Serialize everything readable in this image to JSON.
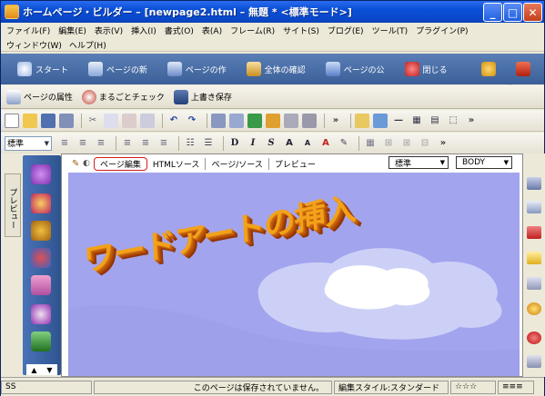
{
  "window": {
    "title": "ホームページ・ビルダー – [newpage2.html – 無題 * <標準モード>]"
  },
  "menu": {
    "row1": [
      "ファイル(F)",
      "編集(E)",
      "表示(V)",
      "挿入(I)",
      "書式(O)",
      "表(A)",
      "フレーム(R)",
      "サイト(S)",
      "ブログ(E)",
      "ツール(T)",
      "プラグイン(P)"
    ],
    "row2": [
      "ウィンドウ(W)",
      "ヘルプ(H)"
    ]
  },
  "taskbar": {
    "items": [
      "スタート",
      "ページの新",
      "ページの作",
      "全体の確認",
      "ページの公",
      "閉じる"
    ]
  },
  "toolbar2": {
    "items": [
      "ページの属性",
      "まるごとチェック",
      "上書き保存"
    ]
  },
  "format": {
    "style_value": "標準"
  },
  "leftpanel": {
    "tab_label": "プレビュー"
  },
  "doc": {
    "tabs": [
      "ページ編集",
      "HTMLソース",
      "ページ/ソース",
      "プレビュー"
    ],
    "dd_style": "標準",
    "dd_body": "BODY",
    "wordart": "ワードアートの挿入"
  },
  "status": {
    "left": "SS",
    "message": "このページは保存されていません。",
    "mode": "編集スタイル:スタンダード",
    "extra": "≡≡≡"
  },
  "colors": {
    "canvas": "#a3a4ee",
    "wordart": "#f2a21a",
    "title_bar": "#0a4fd6"
  }
}
